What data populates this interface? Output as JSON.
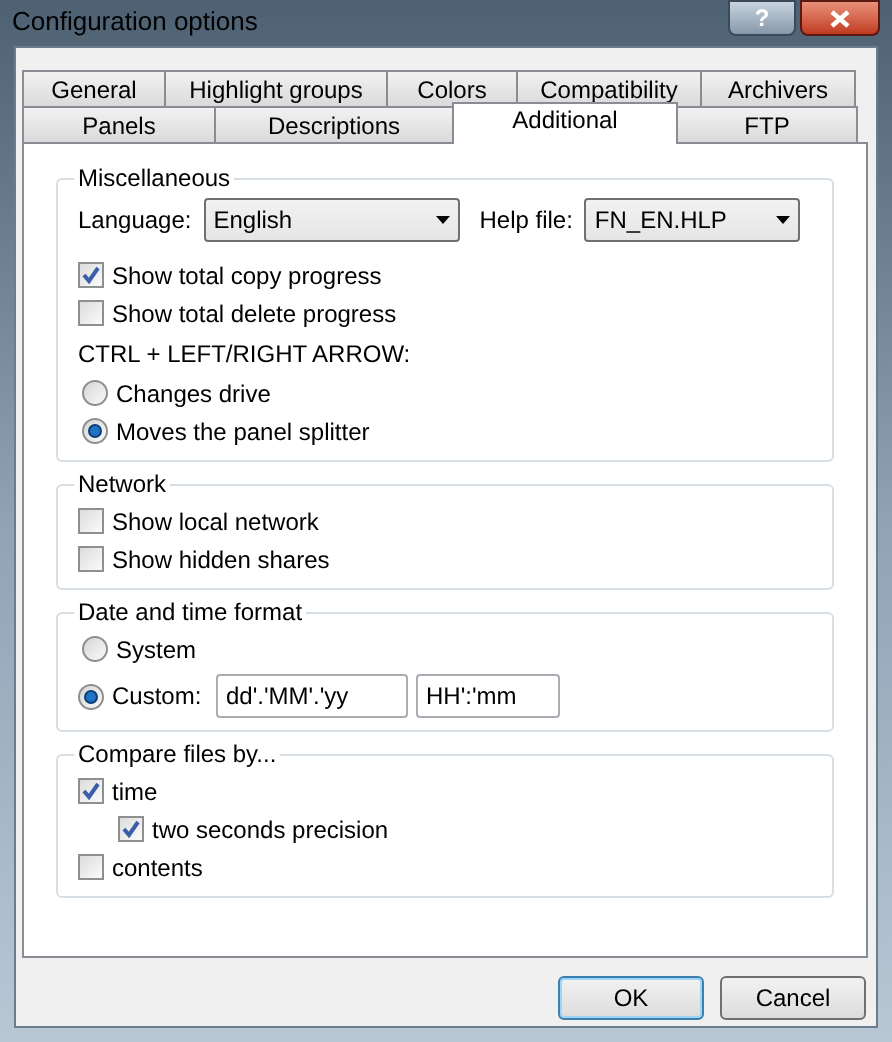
{
  "window": {
    "title": "Configuration options",
    "help_button": "?"
  },
  "tab_rows": [
    [
      {
        "label": "General",
        "selected": false
      },
      {
        "label": "Highlight groups",
        "selected": false
      },
      {
        "label": "Colors",
        "selected": false
      },
      {
        "label": "Compatibility",
        "selected": false
      },
      {
        "label": "Archivers",
        "selected": false
      }
    ],
    [
      {
        "label": "Panels",
        "selected": false
      },
      {
        "label": "Descriptions",
        "selected": false
      },
      {
        "label": "Additional",
        "selected": true
      },
      {
        "label": "FTP",
        "selected": false
      }
    ]
  ],
  "groups": [
    {
      "title": "Miscellaneous",
      "items": [
        {
          "kind": "dropdowns",
          "fields": [
            {
              "label": "Language:",
              "value": "English"
            },
            {
              "label": "Help file:",
              "value": "FN_EN.HLP"
            }
          ]
        },
        {
          "kind": "checkbox",
          "label": "Show total copy progress",
          "checked": true
        },
        {
          "kind": "checkbox",
          "label": "Show total delete progress",
          "checked": false
        },
        {
          "kind": "label",
          "label": "CTRL + LEFT/RIGHT ARROW:"
        },
        {
          "kind": "radio",
          "label": "Changes drive",
          "selected": false
        },
        {
          "kind": "radio",
          "label": "Moves the panel splitter",
          "selected": true
        }
      ]
    },
    {
      "title": "Network",
      "items": [
        {
          "kind": "checkbox",
          "label": "Show local network",
          "checked": false
        },
        {
          "kind": "checkbox",
          "label": "Show hidden shares",
          "checked": false
        }
      ]
    },
    {
      "title": "Date and time format",
      "items": [
        {
          "kind": "radio",
          "label": "System",
          "selected": false
        },
        {
          "kind": "radio",
          "label": "Custom:",
          "selected": true,
          "fields": [
            "dd'.'MM'.'yy",
            "HH':'mm"
          ]
        }
      ]
    },
    {
      "title": "Compare files by...",
      "items": [
        {
          "kind": "checkbox",
          "label": "time",
          "checked": true,
          "children": [
            {
              "kind": "checkbox",
              "label": "two seconds precision",
              "checked": true
            }
          ]
        },
        {
          "kind": "checkbox",
          "label": "contents",
          "checked": false
        }
      ]
    }
  ],
  "buttons": [
    {
      "label": "OK",
      "default": true
    },
    {
      "label": "Cancel",
      "default": false
    }
  ]
}
